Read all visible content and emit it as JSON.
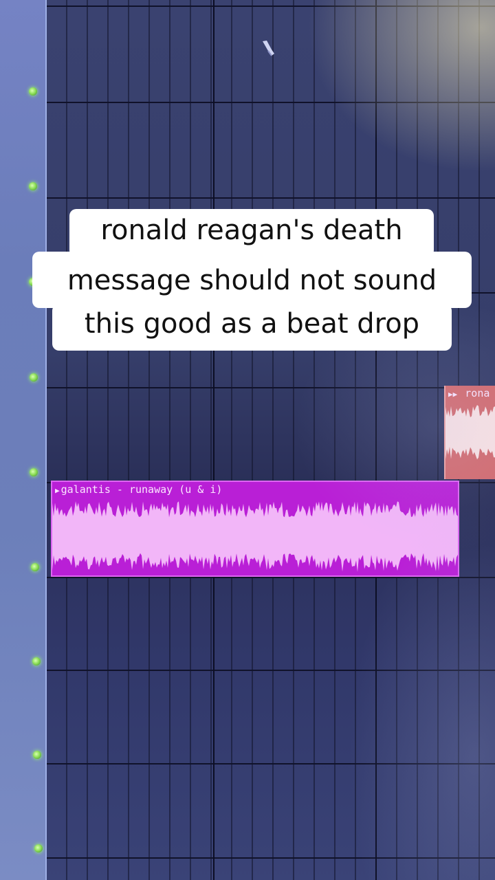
{
  "caption": {
    "lines": [
      "ronald reagan's death",
      "message should not sound",
      "this good as a beat drop"
    ]
  },
  "playlist": {
    "clips": [
      {
        "label": "galantis - runaway (u & i)",
        "color": "#b91fd6"
      },
      {
        "label": "rona",
        "color": "#d46a6d"
      }
    ]
  },
  "icons": {
    "clip_prefix": "play-arrows-icon",
    "cursor": "paint-brush-cursor-icon",
    "track_led": "track-activity-led-icon"
  },
  "colors": {
    "grid_background": "#363e6a",
    "track_header": "#6f80bd",
    "led": "#8fe05a"
  }
}
